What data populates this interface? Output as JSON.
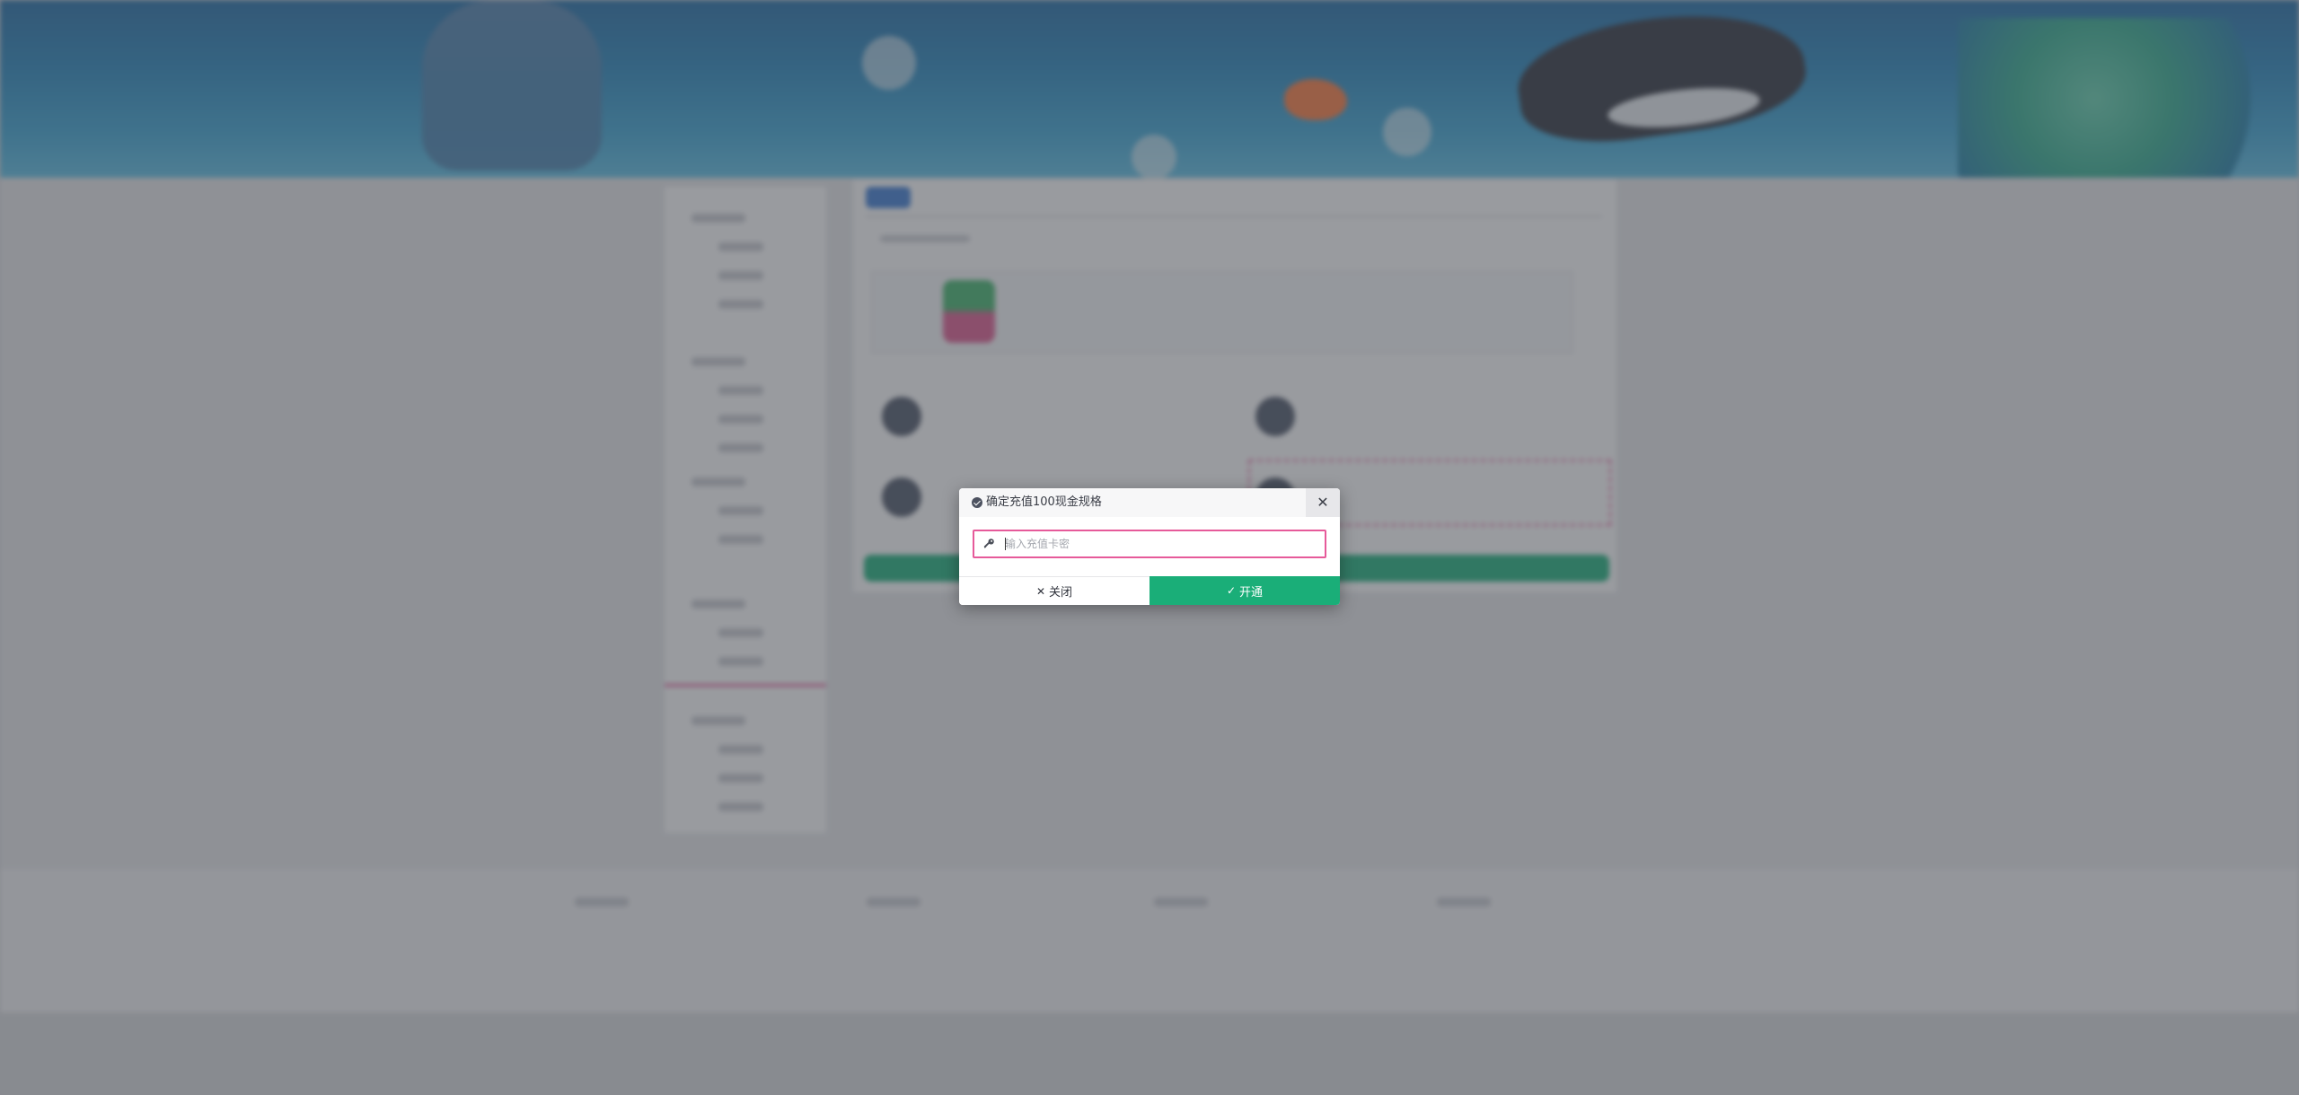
{
  "modal": {
    "title": "确定充值100现金规格",
    "close_icon": "close-icon",
    "input_placeholder": "输入充值卡密",
    "input_value": "",
    "input_icon": "key-icon",
    "close_button_label": "关闭",
    "close_button_icon": "x-icon",
    "confirm_button_label": "开通",
    "confirm_button_icon": "check-icon"
  },
  "colors": {
    "accent_pink": "#e65a9a",
    "confirm_green": "#1aae78",
    "overlay": "rgba(70,72,80,0.55)"
  }
}
